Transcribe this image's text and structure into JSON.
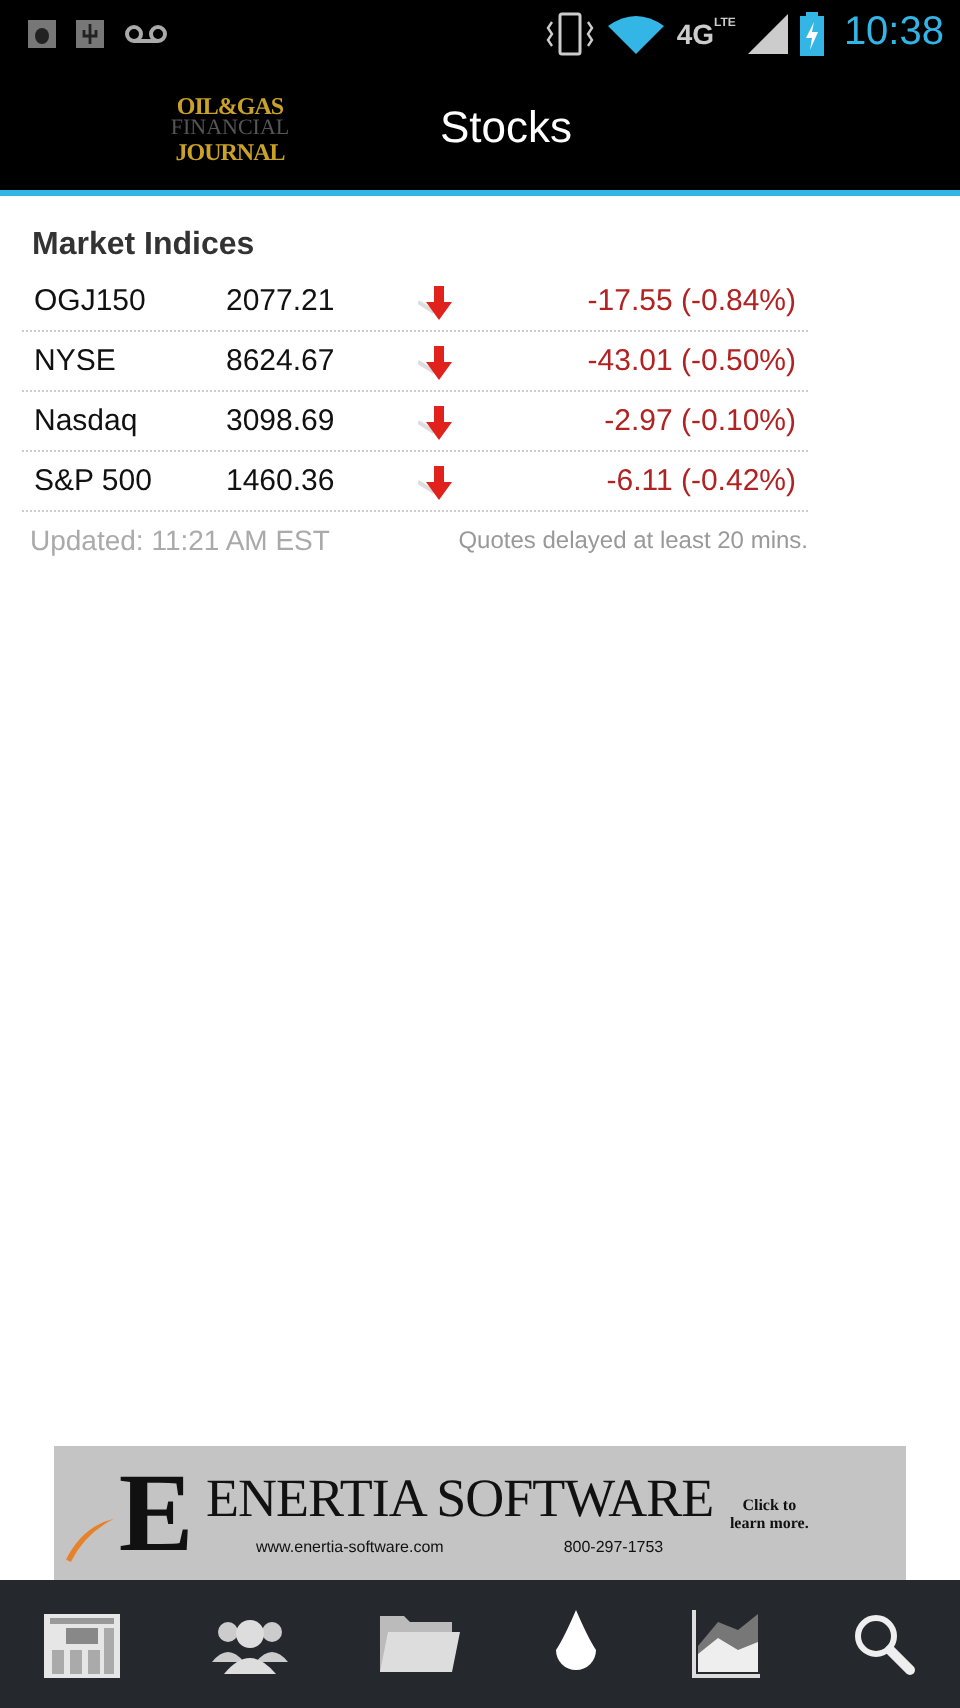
{
  "status_bar": {
    "network": "4G",
    "network_sub": "LTE",
    "time": "10:38"
  },
  "header": {
    "logo": [
      "OIL&GAS",
      "FINANCIAL",
      "JOURNAL"
    ],
    "title": "Stocks"
  },
  "market": {
    "title": "Market Indices",
    "rows": [
      {
        "name": "OGJ150",
        "value": "2077.21",
        "falling": true,
        "change": "-17.55 (-0.84%)"
      },
      {
        "name": "NYSE",
        "value": "8624.67",
        "falling": true,
        "change": "-43.01 (-0.50%)"
      },
      {
        "name": "Nasdaq",
        "value": "3098.69",
        "falling": true,
        "change": "-2.97 (-0.10%)"
      },
      {
        "name": "S&P 500",
        "value": "1460.36",
        "falling": true,
        "change": "-6.11 (-0.42%)"
      }
    ],
    "updated": "Updated: 11:21 AM EST",
    "note": "Quotes delayed at least 20 mins."
  },
  "ad": {
    "initial": "E",
    "name": "ENERTIA SOFTWARE",
    "url": "www.enertia-software.com",
    "phone": "800-297-1753",
    "cta": "Click to learn more."
  }
}
